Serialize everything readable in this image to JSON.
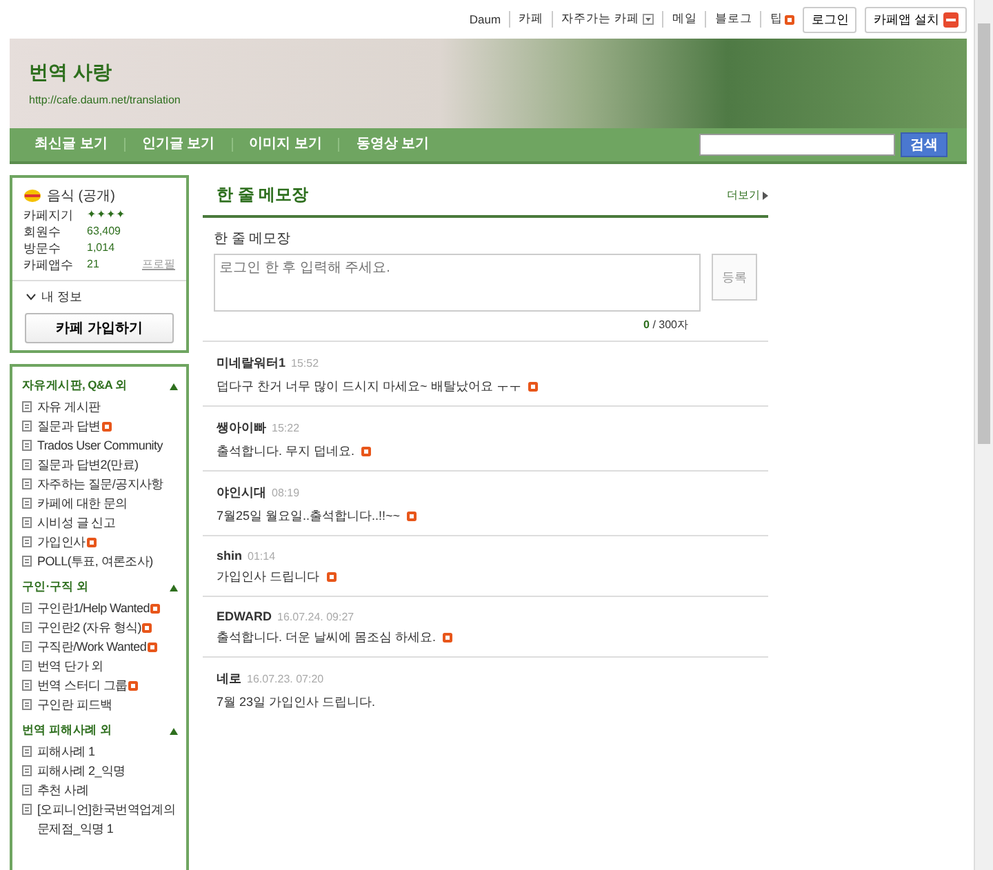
{
  "top_links": [
    {
      "label": "Daum"
    },
    {
      "label": "카페"
    },
    {
      "label": "자주가는 카페",
      "dropdown": true
    },
    {
      "label": "메일"
    },
    {
      "label": "블로그"
    },
    {
      "label": "팁",
      "new": true
    }
  ],
  "top_buttons": [
    {
      "label": "로그인",
      "kind": "plain"
    },
    {
      "label": "카페앱 설치",
      "kind": "app"
    }
  ],
  "cafe": {
    "title": "번역 사랑",
    "url": "http://cafe.daum.net/translation"
  },
  "nav": [
    {
      "label": "최신글 보기"
    },
    {
      "label": "인기글 보기"
    },
    {
      "label": "이미지 보기"
    },
    {
      "label": "동영상 보기"
    }
  ],
  "search": {
    "button": "검색"
  },
  "info": {
    "category": "음식 (공개)",
    "stats": [
      {
        "label": "카페지기",
        "value": "✦✦✦✦"
      },
      {
        "label": "회원수",
        "value": "63,409"
      },
      {
        "label": "방문수",
        "value": "1,014"
      },
      {
        "label": "카페앱수",
        "value": "21",
        "link": "프로필"
      }
    ],
    "my_info": "내 정보",
    "join": "카페 가입하기"
  },
  "menu": [
    {
      "title": "자유게시판, Q&A 외",
      "expanded": true,
      "items": [
        {
          "label": "자유 게시판",
          "new": false
        },
        {
          "label": "질문과 답변",
          "new": true
        },
        {
          "label": "Trados User Community",
          "new": false
        },
        {
          "label": "질문과 답변2(만료)",
          "new": false
        },
        {
          "label": "자주하는 질문/공지사항",
          "new": false
        },
        {
          "label": "카페에 대한 문의",
          "new": false
        },
        {
          "label": "시비성 글 신고",
          "new": false
        },
        {
          "label": "가입인사",
          "new": true
        },
        {
          "label": "POLL(투표, 여론조사)",
          "new": false
        }
      ]
    },
    {
      "title": "구인·구직 외",
      "expanded": true,
      "items": [
        {
          "label": "구인란1/Help Wanted",
          "new": true
        },
        {
          "label": "구인란2 (자유 형식)",
          "new": true
        },
        {
          "label": "구직란/Work Wanted",
          "new": true
        },
        {
          "label": "번역 단가 외",
          "new": false
        },
        {
          "label": "번역 스터디 그룹",
          "new": true
        },
        {
          "label": "구인란 피드백",
          "new": false
        }
      ]
    },
    {
      "title": "번역 피해사례 외",
      "expanded": true,
      "items": [
        {
          "label": "피해사례 1",
          "new": false
        },
        {
          "label": "피해사례 2_익명",
          "new": false
        },
        {
          "label": "추천 사례",
          "new": false
        },
        {
          "label": "[오피니언]한국번역업계의 문제점_익명 1",
          "new": false
        }
      ]
    }
  ],
  "memo": {
    "title": "한 줄 메모장",
    "more": "더보기",
    "label": "한 줄 메모장",
    "placeholder": "로그인 한 후 입력해 주세요.",
    "submit": "등록",
    "count": "0",
    "limit": "/ 300자",
    "entries": [
      {
        "author": "미네랄워터1",
        "time": "15:52",
        "text": "덥다구 찬거 너무 많이 드시지 마세요~ 배탈났어요 ㅜㅜ",
        "new": true
      },
      {
        "author": "쌩아이빠",
        "time": "15:22",
        "text": "출석합니다. 무지 덥네요.",
        "new": true
      },
      {
        "author": "야인시대",
        "time": "08:19",
        "text": "7월25일 월요일..출석합니다..!!~~",
        "new": true
      },
      {
        "author": "shin",
        "time": "01:14",
        "text": "가입인사 드립니다",
        "new": true
      },
      {
        "author": "EDWARD",
        "time": "16.07.24. 09:27",
        "text": "출석합니다. 더운 날씨에 몸조심 하세요.",
        "new": true
      },
      {
        "author": "네로",
        "time": "16.07.23. 07:20",
        "text": "7월 23일 가입인사 드립니다.",
        "new": false
      }
    ]
  }
}
